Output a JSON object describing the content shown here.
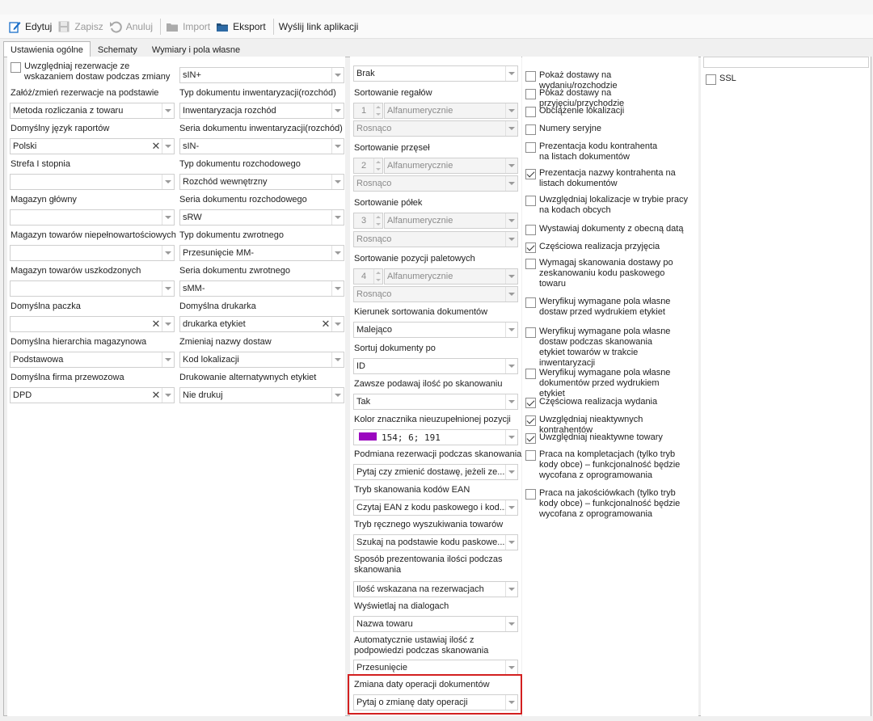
{
  "toolbar": {
    "edit": "Edytuj",
    "save": "Zapisz",
    "cancel": "Anuluj",
    "import": "Import",
    "export": "Eksport",
    "send_link": "Wyślij link aplikacji"
  },
  "tabs": [
    "Ustawienia ogólne",
    "Schematy",
    "Wymiary i pola własne"
  ],
  "col1": {
    "reservation_checkbox": "Uwzględniaj rezerwacje ze wskazaniem dostaw podczas zmiany",
    "fields": [
      {
        "label": "Załóż/zmień rezerwacje na podstawie",
        "value": "Metoda rozliczania z towaru"
      },
      {
        "label": "Domyślny język raportów",
        "value": "Polski"
      },
      {
        "label": "Strefa I stopnia",
        "value": ""
      },
      {
        "label": "Magazyn główny",
        "value": ""
      },
      {
        "label": "Magazyn towarów niepełnowartościowych",
        "value": ""
      },
      {
        "label": "Magazyn towarów uszkodzonych",
        "value": ""
      },
      {
        "label": "Domyślna paczka",
        "value": ""
      },
      {
        "label": "Domyślna hierarchia magazynowa",
        "value": "Podstawowa"
      },
      {
        "label": "Domyślna firma przewozowa",
        "value": "DPD"
      }
    ]
  },
  "col2": {
    "top_value": "sIN+",
    "fields": [
      {
        "label": "Typ dokumentu inwentaryzacji(rozchód)",
        "value": "Inwentaryzacja rozchód"
      },
      {
        "label": "Seria dokumentu inwentaryzacji(rozchód)",
        "value": "sIN-"
      },
      {
        "label": "Typ dokumentu rozchodowego",
        "value": "Rozchód wewnętrzny"
      },
      {
        "label": "Seria dokumentu rozchodowego",
        "value": "sRW"
      },
      {
        "label": "Typ dokumentu zwrotnego",
        "value": "Przesunięcie MM-"
      },
      {
        "label": "Seria dokumentu zwrotnego",
        "value": "sMM-"
      },
      {
        "label": "Domyślna drukarka",
        "value": "drukarka etykiet"
      },
      {
        "label": "Zmieniaj nazwy dostaw",
        "value": "Kod lokalizacji"
      },
      {
        "label": "Drukowanie alternatywnych etykiet",
        "value": "Nie drukuj"
      }
    ]
  },
  "col3": {
    "top_value": "Brak",
    "sorting": [
      {
        "label": "Sortowanie regałów",
        "num": "1",
        "mode": "Alfanumerycznie",
        "order": "Rosnąco"
      },
      {
        "label": "Sortowanie przęseł",
        "num": "2",
        "mode": "Alfanumerycznie",
        "order": "Rosnąco"
      },
      {
        "label": "Sortowanie półek",
        "num": "3",
        "mode": "Alfanumerycznie",
        "order": "Rosnąco"
      },
      {
        "label": "Sortowanie pozycji paletowych",
        "num": "4",
        "mode": "Alfanumerycznie",
        "order": "Rosnąco"
      }
    ],
    "fields": [
      {
        "label": "Kierunek sortowania dokumentów",
        "value": "Malejąco"
      },
      {
        "label": "Sortuj dokumenty po",
        "value": "ID"
      },
      {
        "label": "Zawsze podawaj ilość po skanowaniu",
        "value": "Tak"
      },
      {
        "label": "Kolor znacznika nieuzupełnionej pozycji",
        "value": "154; 6; 191"
      },
      {
        "label": "Podmiana rezerwacji podczas skanowania",
        "value": "Pytaj czy zmienić dostawę, jeżeli ze..."
      },
      {
        "label": "Tryb skanowania kodów EAN",
        "value": "Czytaj EAN z kodu paskowego i kod..."
      },
      {
        "label": "Tryb ręcznego wyszukiwania towarów",
        "value": "Szukaj na podstawie kodu paskowe..."
      },
      {
        "label": "Sposób prezentowania ilości podczas skanowania",
        "value": "Ilość wskazana na rezerwacjach"
      },
      {
        "label": "Wyświetlaj na dialogach",
        "value": "Nazwa towaru"
      },
      {
        "label": "Automatycznie ustawiaj ilość z podpowiedzi podczas skanowania",
        "value": "Przesunięcie"
      },
      {
        "label": "Zmiana daty operacji dokumentów",
        "value": "Pytaj o zmianę daty operacji"
      }
    ],
    "color_hex": "#9a06bf"
  },
  "col4": {
    "checkboxes": [
      {
        "label": "Pokaż dostawy na wydaniu/rozchodzie",
        "checked": false
      },
      {
        "label": "Pokaż dostawy na przyjęciu/przychodzie",
        "checked": false
      },
      {
        "label": "Obciążenie lokalizacji",
        "checked": false
      },
      {
        "label": "Numery seryjne",
        "checked": false
      },
      {
        "label": "Prezentacja kodu kontrahenta na listach dokumentów",
        "checked": false
      },
      {
        "label": "Prezentacja nazwy kontrahenta na listach dokumentów",
        "checked": true
      },
      {
        "label": "Uwzględniaj lokalizacje w trybie pracy na kodach obcych",
        "checked": false
      },
      {
        "label": "Wystawiaj dokumenty z obecną datą",
        "checked": false
      },
      {
        "label": "Częściowa realizacja przyjęcia",
        "checked": true
      },
      {
        "label": "Wymagaj skanowania dostawy po zeskanowaniu kodu paskowego towaru",
        "checked": false
      },
      {
        "label": "Weryfikuj wymagane pola własne dostaw przed wydrukiem etykiet",
        "checked": false
      },
      {
        "label": "Weryfikuj wymagane pola własne dostaw podczas skanowania etykiet towarów w trakcie inwentaryzacji",
        "checked": false
      },
      {
        "label": "Weryfikuj wymagane pola własne dokumentów przed wydrukiem etykiet",
        "checked": false
      },
      {
        "label": "Częściowa realizacja wydania",
        "checked": true
      },
      {
        "label": "Uwzględniaj nieaktywnych kontrahentów",
        "checked": true
      },
      {
        "label": "Uwzględniaj nieaktywne towary",
        "checked": true
      },
      {
        "label": "Praca na kompletacjach (tylko tryb kody obce) – funkcjonalność będzie wycofana z oprogramowania",
        "checked": false
      },
      {
        "label": "Praca na jakościówkach (tylko tryb kody obce) – funkcjonalność będzie wycofana z oprogramowania",
        "checked": false
      }
    ]
  },
  "col5": {
    "ssl": "SSL"
  },
  "accent": {
    "highlight": "#d32020"
  }
}
